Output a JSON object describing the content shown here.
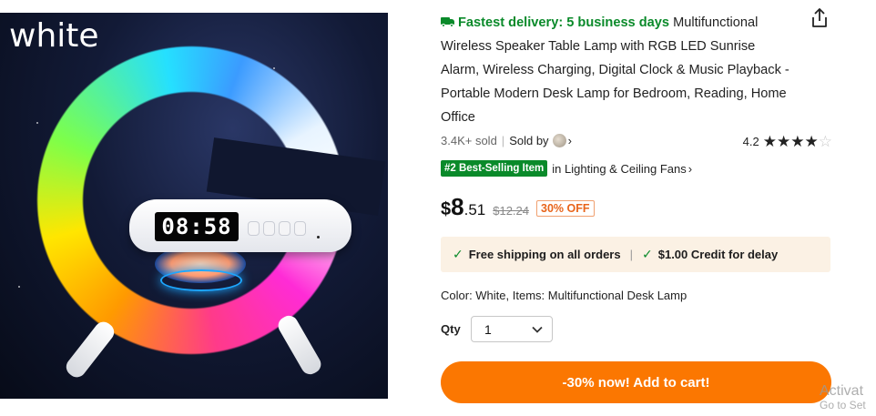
{
  "image": {
    "caption": "white",
    "clock_text": "08:58"
  },
  "product": {
    "delivery_label": "Fastest delivery: 5 business days",
    "title": "Multifunctional Wireless Speaker Table Lamp with RGB LED Sunrise Alarm, Wireless Charging, Digital Clock & Music Playback - Portable Modern Desk Lamp for Bedroom, Reading, Home Office",
    "sold_count": "3.4K+ sold",
    "sold_by_label": "Sold by",
    "rating_value": "4.2",
    "rating_stars": 4.2,
    "rank_badge": "#2 Best-Selling Item",
    "rank_category": "in Lighting & Ceiling Fans",
    "price": {
      "symbol": "$",
      "whole": "8",
      "cents": ".51",
      "original": "$12.24",
      "discount": "30% OFF"
    },
    "shipping_banner": {
      "item1": "Free shipping on all orders",
      "item2": "$1.00 Credit for delay"
    },
    "variant": "Color: White, Items: Multifunctional Desk Lamp",
    "qty_label": "Qty",
    "qty_value": "1",
    "cart_button": "-30% now! Add to cart!"
  },
  "watermark": {
    "line1": "Activat",
    "line2": "Go to Set"
  },
  "colors": {
    "brand_orange": "#fb7701",
    "delivery_green": "#0a8a2a",
    "discount_orange": "#e8641a",
    "banner_bg": "#fbf1e4"
  }
}
